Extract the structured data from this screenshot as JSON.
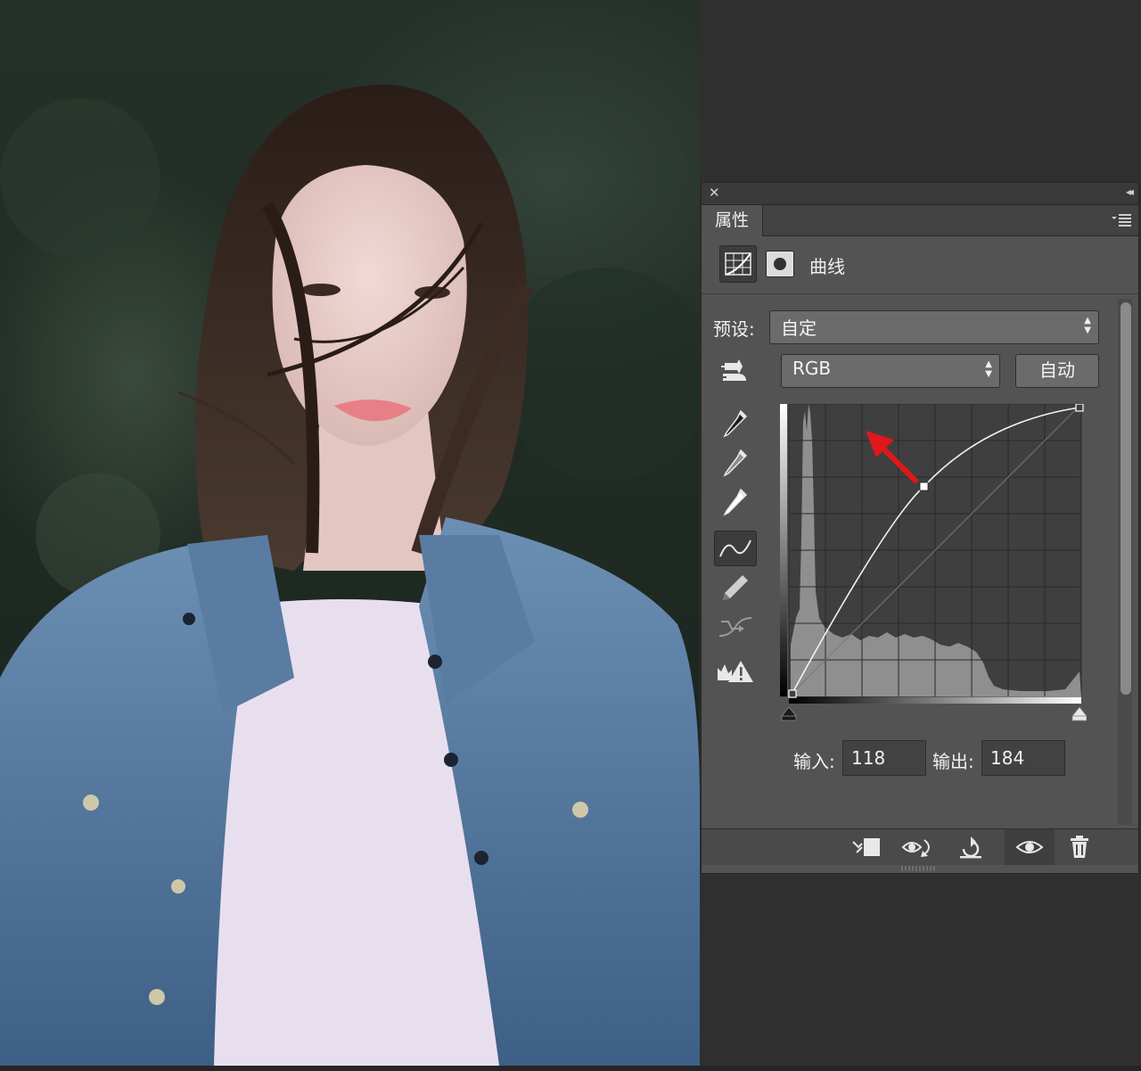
{
  "photo": {
    "subject": "portrait-photo"
  },
  "panel": {
    "tab_label": "属性",
    "adjustment_name": "曲线",
    "preset_label": "预设:",
    "preset_value": "自定",
    "channel_value": "RGB",
    "auto_label": "自动",
    "input_label": "输入:",
    "input_value": "118",
    "output_label": "输出:",
    "output_value": "184",
    "curve_point": {
      "input": 118,
      "output": 184
    },
    "icons": {
      "close": "close-icon",
      "collapse": "collapse-icon",
      "menu": "panel-menu-icon",
      "curves": "curves-adjustment-icon",
      "mask": "mask-icon",
      "targeted": "targeted-adjustment-icon",
      "eyedropper_black": "black-point-eyedropper-icon",
      "eyedropper_gray": "gray-point-eyedropper-icon",
      "eyedropper_white": "white-point-eyedropper-icon",
      "point_edit": "point-curve-icon",
      "pencil": "pencil-icon",
      "smooth": "smooth-curve-icon",
      "clipping": "clipping-warning-icon",
      "clip_to_layer": "clip-to-layer-icon",
      "view_previous": "view-previous-icon",
      "reset": "reset-icon",
      "visibility": "eye-icon",
      "delete": "trash-icon"
    },
    "colors": {
      "panel_bg": "#535353",
      "annotation_arrow": "#e0171b"
    }
  }
}
